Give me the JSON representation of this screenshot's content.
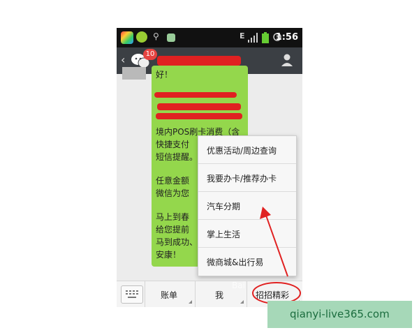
{
  "status_bar": {
    "time": "1:56"
  },
  "title_bar": {
    "back_glyph": "‹",
    "unread_count": "10"
  },
  "chat": {
    "lines": [
      "好！",
      "境内POS刷卡消费（含",
      "快捷支付",
      "短信提醒。",
      "任意金额",
      "微信为您",
      "马上到春",
      "给您提前",
      "马到成功、",
      "安康！"
    ]
  },
  "menu": {
    "items": [
      "优惠活动/周边查询",
      "我要办卡/推荐办卡",
      "汽车分期",
      "掌上生活",
      "微商城&出行易"
    ]
  },
  "bottom_bar": {
    "tabs": [
      "账单",
      "我",
      "招招精彩"
    ]
  },
  "watermarks": {
    "site": "qianyi-live365.com",
    "baidu": "Bai"
  },
  "colors": {
    "bubble": "#94d74c",
    "header": "#3b3f44",
    "annotation": "#e02121",
    "badge": "#e64340"
  }
}
